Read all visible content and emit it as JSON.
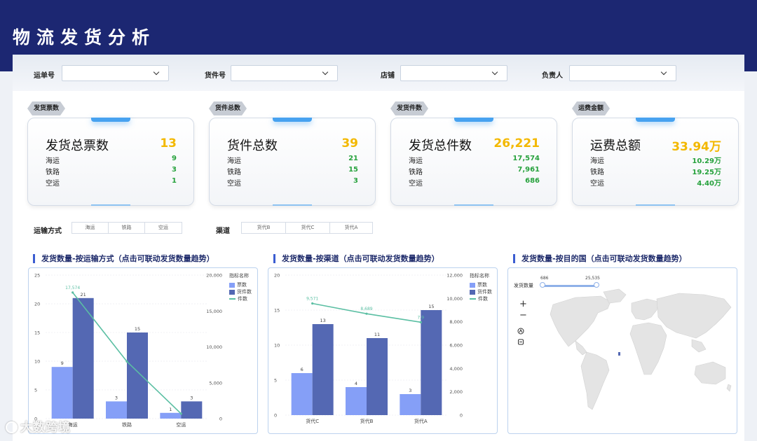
{
  "header": {
    "title": "物流发货分析"
  },
  "filters": [
    {
      "label": "运单号",
      "value": ""
    },
    {
      "label": "货件号",
      "value": ""
    },
    {
      "label": "店铺",
      "value": ""
    },
    {
      "label": "负责人",
      "value": ""
    }
  ],
  "kpis": [
    {
      "tag": "发货票数",
      "title": "发货总票数",
      "total": "13",
      "rows": [
        {
          "k": "海运",
          "v": "9"
        },
        {
          "k": "铁路",
          "v": "3"
        },
        {
          "k": "空运",
          "v": "1"
        }
      ]
    },
    {
      "tag": "货件总数",
      "title": "货件总数",
      "total": "39",
      "rows": [
        {
          "k": "海运",
          "v": "21"
        },
        {
          "k": "铁路",
          "v": "15"
        },
        {
          "k": "空运",
          "v": "3"
        }
      ]
    },
    {
      "tag": "发货件数",
      "title": "发货总件数",
      "total": "26,221",
      "rows": [
        {
          "k": "海运",
          "v": "17,574"
        },
        {
          "k": "铁路",
          "v": "7,961"
        },
        {
          "k": "空运",
          "v": "686"
        }
      ]
    },
    {
      "tag": "运费金额",
      "title": "运费总额",
      "total": "33.94万",
      "rows": [
        {
          "k": "海运",
          "v": "10.29万"
        },
        {
          "k": "铁路",
          "v": "19.25万"
        },
        {
          "k": "空运",
          "v": "4.40万"
        }
      ]
    }
  ],
  "slicers": {
    "transport": {
      "label": "运输方式",
      "options": [
        "海运",
        "铁路",
        "空运"
      ]
    },
    "channel": {
      "label": "渠道",
      "options": [
        "货代B",
        "货代C",
        "货代A"
      ]
    }
  },
  "colors": {
    "header": "#1c2772",
    "bar_tickets": "#859ff7",
    "bar_shipments": "#5468b3",
    "line_pieces": "#5bbfa3",
    "kpi_total": "#f3b800",
    "kpi_value": "#27a23d"
  },
  "chart_data": [
    {
      "type": "bar",
      "title": "发货数量-按运输方式（点击可联动发货数量趋势）",
      "legend_title": "指标名称",
      "categories": [
        "海运",
        "铁路",
        "空运"
      ],
      "series": [
        {
          "name": "票数",
          "axis": "left",
          "kind": "bar",
          "values": [
            9,
            3,
            1
          ]
        },
        {
          "name": "货件数",
          "axis": "left",
          "kind": "bar",
          "values": [
            21,
            15,
            3
          ]
        },
        {
          "name": "件数",
          "axis": "right",
          "kind": "line",
          "values": [
            17574,
            7961,
            686
          ],
          "labels": [
            "17,574",
            "",
            ""
          ]
        }
      ],
      "ylim": [
        0,
        25
      ],
      "yticks": [
        "0",
        "5",
        "10",
        "15",
        "20",
        "25"
      ],
      "y2lim": [
        0,
        20000
      ],
      "y2ticks": [
        "0",
        "5,000",
        "10,000",
        "15,000",
        "20,000"
      ],
      "legend_position": "top-right"
    },
    {
      "type": "bar",
      "title": "发货数量-按渠道（点击可联动发货数量趋势）",
      "legend_title": "指标名称",
      "categories": [
        "货代C",
        "货代B",
        "货代A"
      ],
      "series": [
        {
          "name": "票数",
          "axis": "left",
          "kind": "bar",
          "values": [
            6,
            4,
            3
          ]
        },
        {
          "name": "货件数",
          "axis": "left",
          "kind": "bar",
          "values": [
            13,
            11,
            15
          ]
        },
        {
          "name": "件数",
          "axis": "right",
          "kind": "line",
          "values": [
            9571,
            8689,
            7961
          ],
          "labels": [
            "9,571",
            "8,689",
            "7,9"
          ]
        }
      ],
      "ylim": [
        0,
        20
      ],
      "yticks": [
        "0",
        "5",
        "10",
        "15",
        "20"
      ],
      "y2lim": [
        0,
        12000
      ],
      "y2ticks": [
        "0",
        "2,000",
        "4,000",
        "6,000",
        "8,000",
        "10,000",
        "12,000"
      ],
      "legend_position": "top-right"
    }
  ],
  "map": {
    "title": "发货数量-按目的国（点击可联动发货数量趋势）",
    "slider_label": "发货数量",
    "slider_min": "686",
    "slider_max": "25,535",
    "zoom_in": "+",
    "zoom_out": "−"
  },
  "watermark": "大数跨境"
}
